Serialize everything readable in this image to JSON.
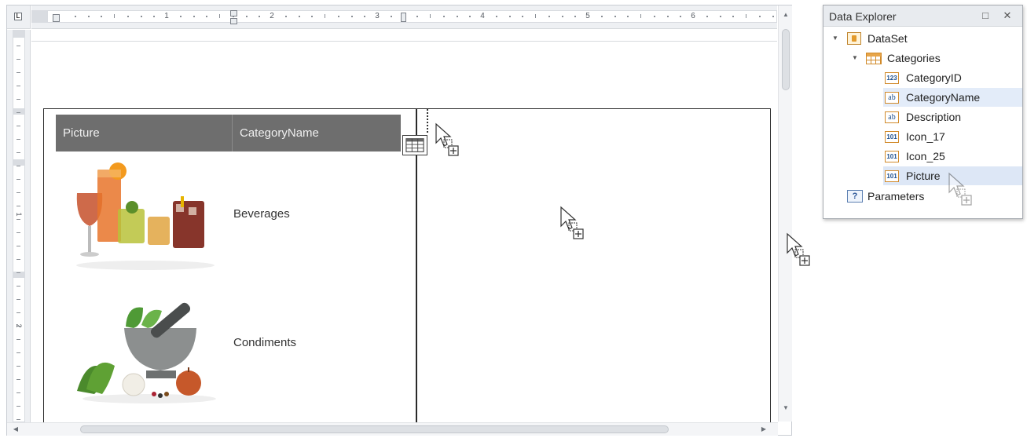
{
  "ruler": {
    "corner_glyph": "L",
    "numbers": [
      "1",
      "2",
      "3",
      "4",
      "5",
      "6"
    ],
    "vertical_numbers": [
      "1",
      "2"
    ]
  },
  "table": {
    "headers": [
      "Picture",
      "CategoryName"
    ],
    "rows": [
      {
        "category_name": "Beverages",
        "picture": "beverages-image"
      },
      {
        "category_name": "Condiments",
        "picture": "condiments-image"
      }
    ]
  },
  "data_explorer": {
    "title": "Data Explorer",
    "restore_icon": "□",
    "close_icon": "✕",
    "tree": {
      "dataset": {
        "label": "DataSet",
        "expander": "▼"
      },
      "table": {
        "label": "Categories",
        "expander": "▼"
      },
      "fields": [
        {
          "label": "CategoryID",
          "type_badge": "123"
        },
        {
          "label": "CategoryName",
          "type_badge": "ab"
        },
        {
          "label": "Description",
          "type_badge": "ab"
        },
        {
          "label": "Icon_17",
          "type_badge": "101"
        },
        {
          "label": "Icon_25",
          "type_badge": "101"
        },
        {
          "label": "Picture",
          "type_badge": "101"
        }
      ],
      "parameters": {
        "label": "Parameters",
        "badge": "?"
      }
    }
  },
  "scrollbars": {
    "up": "▲",
    "down": "▼",
    "left": "◀",
    "right": "▶"
  },
  "colors": {
    "header_bg": "#6e6e6e",
    "header_text": "#f0f0f0",
    "selection": "#e3ecf9",
    "field_icon_border": "#d18a2a"
  }
}
